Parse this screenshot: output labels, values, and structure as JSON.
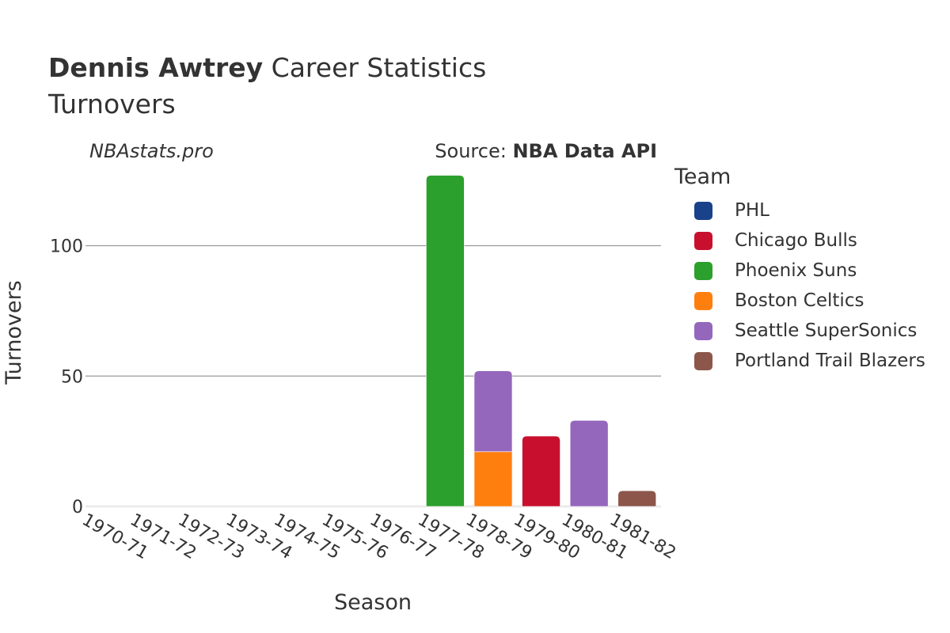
{
  "header": {
    "title_bold": "Dennis Awtrey",
    "title_rest": " Career Statistics",
    "subtitle": "Turnovers",
    "credit": "NBAstats.pro",
    "source_prefix": "Source: ",
    "source_name": "NBA Data API"
  },
  "legend": {
    "title": "Team",
    "items": [
      {
        "label": "PHL",
        "color": "#1a428a"
      },
      {
        "label": "Chicago Bulls",
        "color": "#c8102e"
      },
      {
        "label": "Phoenix Suns",
        "color": "#2ca02c"
      },
      {
        "label": "Boston Celtics",
        "color": "#ff7f0e"
      },
      {
        "label": "Seattle SuperSonics",
        "color": "#9467bd"
      },
      {
        "label": "Portland Trail Blazers",
        "color": "#8c564b"
      }
    ]
  },
  "chart_data": {
    "type": "bar",
    "stacked": true,
    "title": "Dennis Awtrey Career Statistics",
    "subtitle": "Turnovers",
    "xlabel": "Season",
    "ylabel": "Turnovers",
    "ylim": [
      0,
      130
    ],
    "yticks": [
      0,
      50,
      100
    ],
    "grid": true,
    "legend_position": "right",
    "categories": [
      "1970-71",
      "1971-72",
      "1972-73",
      "1973-74",
      "1974-75",
      "1975-76",
      "1976-77",
      "1977-78",
      "1978-79",
      "1979-80",
      "1980-81",
      "1981-82"
    ],
    "series": [
      {
        "name": "PHL",
        "color": "#1a428a",
        "values": [
          0,
          0,
          0,
          0,
          0,
          0,
          0,
          0,
          0,
          0,
          0,
          0
        ]
      },
      {
        "name": "Chicago Bulls",
        "color": "#c8102e",
        "values": [
          0,
          0,
          0,
          0,
          0,
          0,
          0,
          0,
          0,
          27,
          0,
          0
        ]
      },
      {
        "name": "Phoenix Suns",
        "color": "#2ca02c",
        "values": [
          0,
          0,
          0,
          0,
          0,
          0,
          0,
          127,
          0,
          0,
          0,
          0
        ]
      },
      {
        "name": "Boston Celtics",
        "color": "#ff7f0e",
        "values": [
          0,
          0,
          0,
          0,
          0,
          0,
          0,
          0,
          21,
          0,
          0,
          0
        ]
      },
      {
        "name": "Seattle SuperSonics",
        "color": "#9467bd",
        "values": [
          0,
          0,
          0,
          0,
          0,
          0,
          0,
          0,
          31,
          0,
          33,
          0
        ]
      },
      {
        "name": "Portland Trail Blazers",
        "color": "#8c564b",
        "values": [
          0,
          0,
          0,
          0,
          0,
          0,
          0,
          0,
          0,
          0,
          0,
          6
        ]
      }
    ]
  }
}
